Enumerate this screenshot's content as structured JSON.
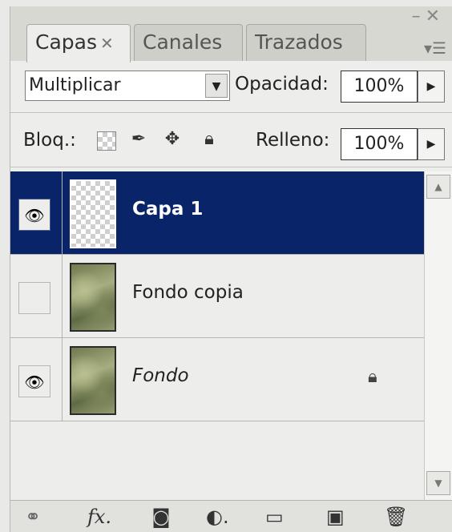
{
  "tabs": [
    {
      "label": "Capas",
      "active": true,
      "closable": true
    },
    {
      "label": "Canales",
      "active": false
    },
    {
      "label": "Trazados",
      "active": false
    }
  ],
  "blend": {
    "mode": "Multiplicar",
    "opacity_label": "Opacidad:",
    "opacity_value": "100%"
  },
  "lock": {
    "label": "Bloq.:",
    "fill_label": "Relleno:",
    "fill_value": "100%",
    "icons": [
      "lock-transparent-pixels-icon",
      "lock-image-pixels-icon",
      "lock-position-icon",
      "lock-all-icon"
    ]
  },
  "layers": [
    {
      "name": "Capa 1",
      "visible": true,
      "selected": true,
      "thumbnail": "transparent",
      "italic": false,
      "locked": false
    },
    {
      "name": "Fondo copia",
      "visible": false,
      "selected": false,
      "thumbnail": "texture",
      "italic": false,
      "locked": false
    },
    {
      "name": "Fondo",
      "visible": true,
      "selected": false,
      "thumbnail": "texture",
      "italic": true,
      "locked": true
    }
  ],
  "footer_icons": [
    "link-layers-icon",
    "layer-style-fx-icon",
    "layer-mask-icon",
    "adjustment-layer-icon",
    "new-group-folder-icon",
    "new-layer-icon",
    "trash-icon"
  ],
  "colors": {
    "selection": "#0a246a",
    "panel": "#ededeb"
  }
}
